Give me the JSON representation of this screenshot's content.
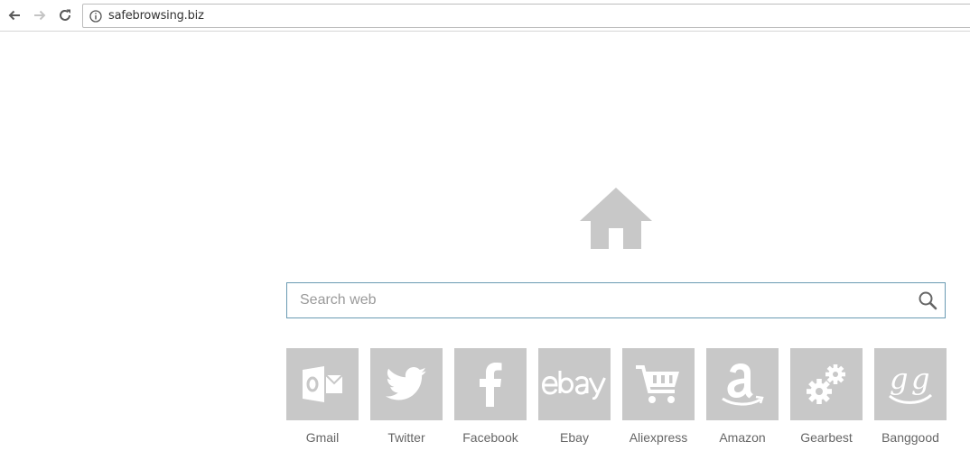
{
  "browser": {
    "url": "safebrowsing.biz"
  },
  "search": {
    "placeholder": "Search web",
    "value": ""
  },
  "tiles": [
    {
      "label": "Gmail",
      "icon": "outlook-icon"
    },
    {
      "label": "Twitter",
      "icon": "twitter-icon"
    },
    {
      "label": "Facebook",
      "icon": "facebook-icon"
    },
    {
      "label": "Ebay",
      "icon": "ebay-icon"
    },
    {
      "label": "Aliexpress",
      "icon": "cart-icon"
    },
    {
      "label": "Amazon",
      "icon": "amazon-icon"
    },
    {
      "label": "Gearbest",
      "icon": "gears-icon"
    },
    {
      "label": "Banggood",
      "icon": "banggood-icon"
    }
  ],
  "colors": {
    "tile": "#c8c8c8",
    "search_border": "#6a9bb3",
    "label": "#666666"
  }
}
